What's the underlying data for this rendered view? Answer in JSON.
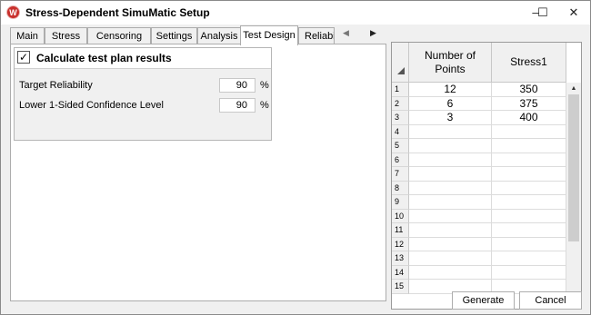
{
  "window": {
    "title": "Stress-Dependent SimuMatic Setup",
    "logo_letter": "W",
    "minimize_glyph": "–",
    "maximize_glyph": "☐",
    "close_glyph": "✕"
  },
  "tabs": [
    {
      "label": "Main"
    },
    {
      "label": "Stress"
    },
    {
      "label": "Censoring"
    },
    {
      "label": "Settings"
    },
    {
      "label": "Analysis"
    },
    {
      "label": "Test Design",
      "active": true
    },
    {
      "label": "Reliabil"
    }
  ],
  "tab_scroll": {
    "left": "◀",
    "right": "▶"
  },
  "test_design": {
    "calculate_label": "Calculate test plan results",
    "calculate_checked": true,
    "check_glyph": "✓",
    "fields": [
      {
        "label": "Target Reliability",
        "value": "90",
        "unit": "%"
      },
      {
        "label": "Lower 1-Sided Confidence Level",
        "value": "90",
        "unit": "%"
      }
    ]
  },
  "grid": {
    "columns": [
      "Number of Points",
      "Stress1"
    ],
    "rows": [
      {
        "num": "1",
        "points": "12",
        "stress": "350"
      },
      {
        "num": "2",
        "points": "6",
        "stress": "375"
      },
      {
        "num": "3",
        "points": "3",
        "stress": "400"
      },
      {
        "num": "4",
        "points": "",
        "stress": ""
      },
      {
        "num": "5",
        "points": "",
        "stress": ""
      },
      {
        "num": "6",
        "points": "",
        "stress": ""
      },
      {
        "num": "7",
        "points": "",
        "stress": ""
      },
      {
        "num": "8",
        "points": "",
        "stress": ""
      },
      {
        "num": "9",
        "points": "",
        "stress": ""
      },
      {
        "num": "10",
        "points": "",
        "stress": ""
      },
      {
        "num": "11",
        "points": "",
        "stress": ""
      },
      {
        "num": "12",
        "points": "",
        "stress": ""
      },
      {
        "num": "13",
        "points": "",
        "stress": ""
      },
      {
        "num": "14",
        "points": "",
        "stress": ""
      },
      {
        "num": "15",
        "points": "",
        "stress": ""
      }
    ],
    "scroll_up": "▲",
    "scroll_down": "▼"
  },
  "buttons": {
    "generate": "Generate",
    "cancel": "Cancel"
  }
}
